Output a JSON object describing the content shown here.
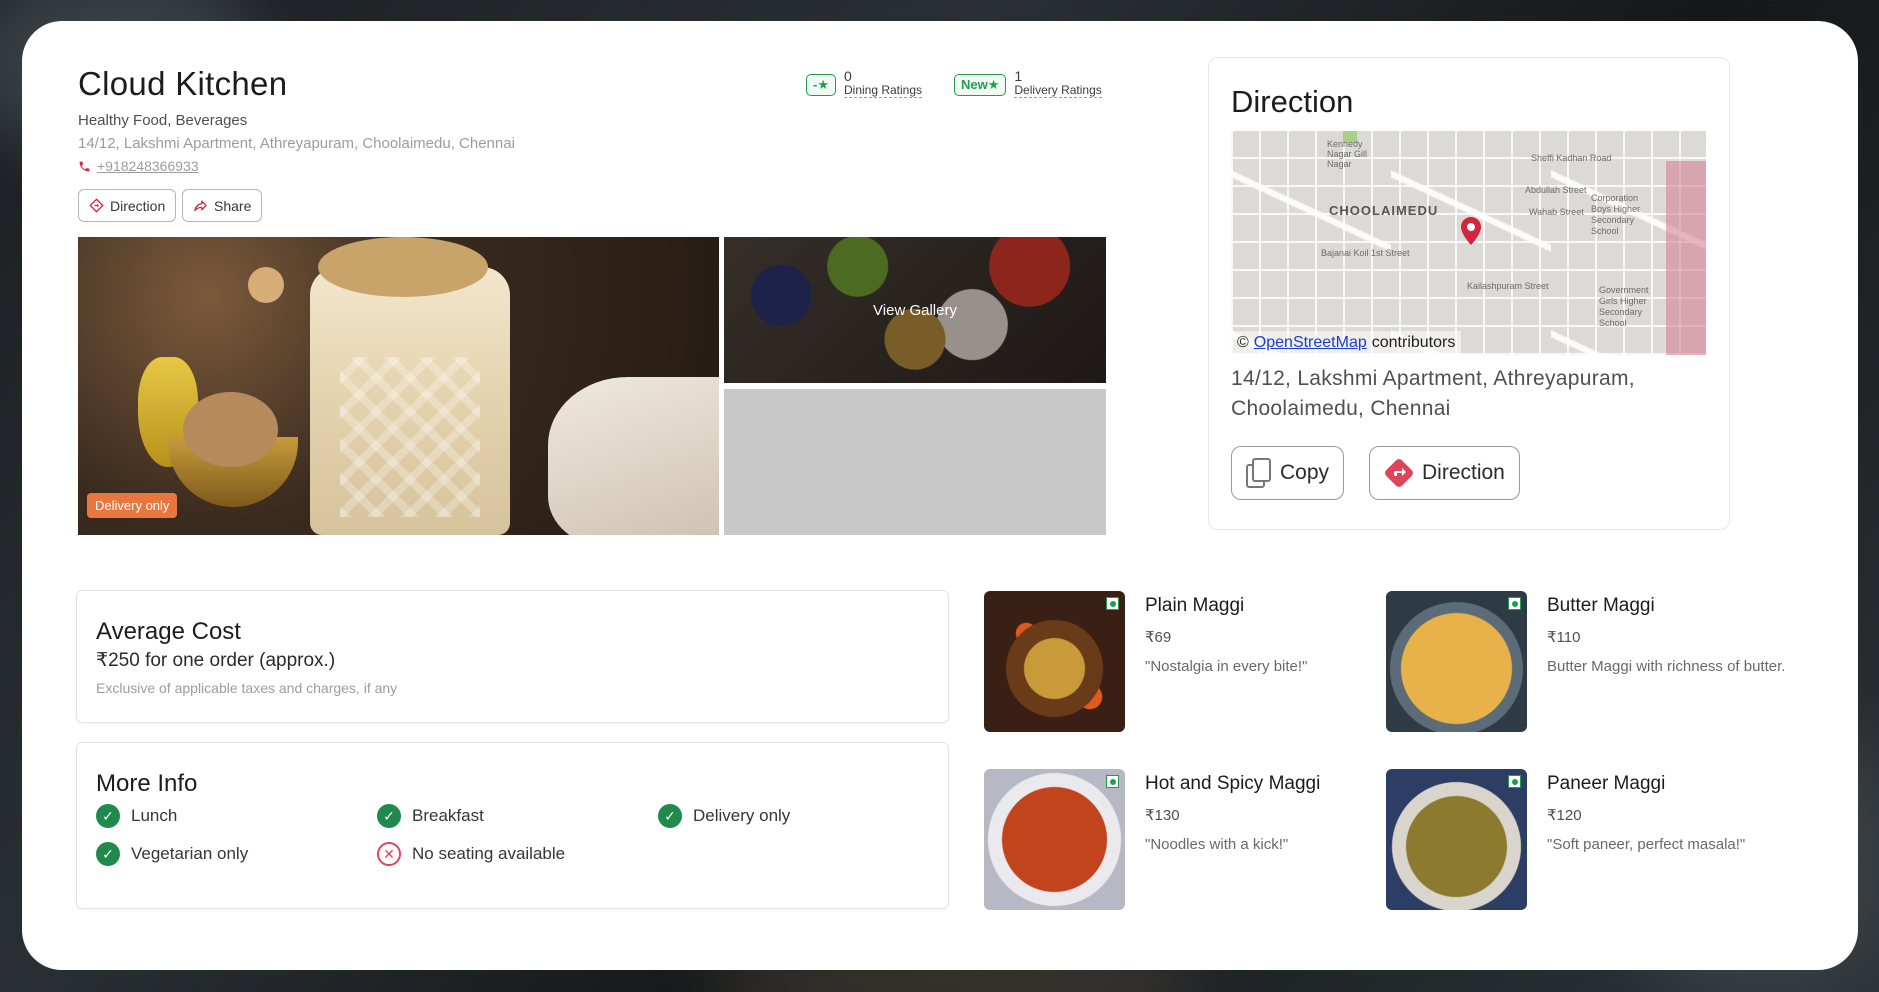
{
  "restaurant": {
    "name": "Cloud Kitchen",
    "cuisines": "Healthy Food, Beverages",
    "address": "14/12, Lakshmi Apartment, Athreyapuram, Choolaimedu, Chennai",
    "phone": "+918248366933"
  },
  "ratings": {
    "dining": {
      "chip": "-★",
      "count": "0",
      "label": "Dining Ratings"
    },
    "delivery": {
      "chip": "New★",
      "count": "1",
      "label": "Delivery Ratings"
    }
  },
  "actions": {
    "direction_label": "Direction",
    "share_label": "Share"
  },
  "gallery": {
    "badge": "Delivery only",
    "view_label": "View Gallery"
  },
  "direction_panel": {
    "title": "Direction",
    "map": {
      "area_label": "CHOOLAIMEDU",
      "streets": [
        "Sheffi Kadhan Road",
        "Abdullah Street",
        "Wahab Street",
        "Bajanai Koil 1st Street",
        "Kailashpuram Street",
        "Corporation Boys Higher Secondary School",
        "Government Girls Higher Secondary School",
        "Kennedy Nagar Gill Nagar"
      ],
      "attribution_icon": "©",
      "attribution_link": "OpenStreetMap",
      "attribution_text": "contributors"
    },
    "address": "14/12, Lakshmi Apartment, Athreyapuram, Choolaimedu, Chennai",
    "copy_label": "Copy",
    "direction_label": "Direction"
  },
  "average_cost": {
    "title": "Average Cost",
    "line": "₹250 for one order (approx.)",
    "note": "Exclusive of applicable taxes and charges, if any"
  },
  "more_info": {
    "title": "More Info",
    "items": [
      {
        "label": "Lunch",
        "available": true
      },
      {
        "label": "Breakfast",
        "available": true
      },
      {
        "label": "Delivery only",
        "available": true
      },
      {
        "label": "Vegetarian only",
        "available": true
      },
      {
        "label": "No seating available",
        "available": false
      }
    ]
  },
  "dishes": [
    {
      "name": "Plain Maggi",
      "price": "₹69",
      "description": "\"Nostalgia in every bite!\""
    },
    {
      "name": "Butter Maggi",
      "price": "₹110",
      "description": "Butter Maggi with richness of butter."
    },
    {
      "name": "Hot and Spicy Maggi",
      "price": "₹130",
      "description": "\"Noodles with a kick!\""
    },
    {
      "name": "Paneer Maggi",
      "price": "₹120",
      "description": "\"Soft paneer, perfect masala!\""
    }
  ],
  "colors": {
    "accent_red": "#d1263c",
    "veg_green": "#1f9e4f",
    "badge_orange": "#e7773e",
    "check_green": "#1f8a4c"
  }
}
